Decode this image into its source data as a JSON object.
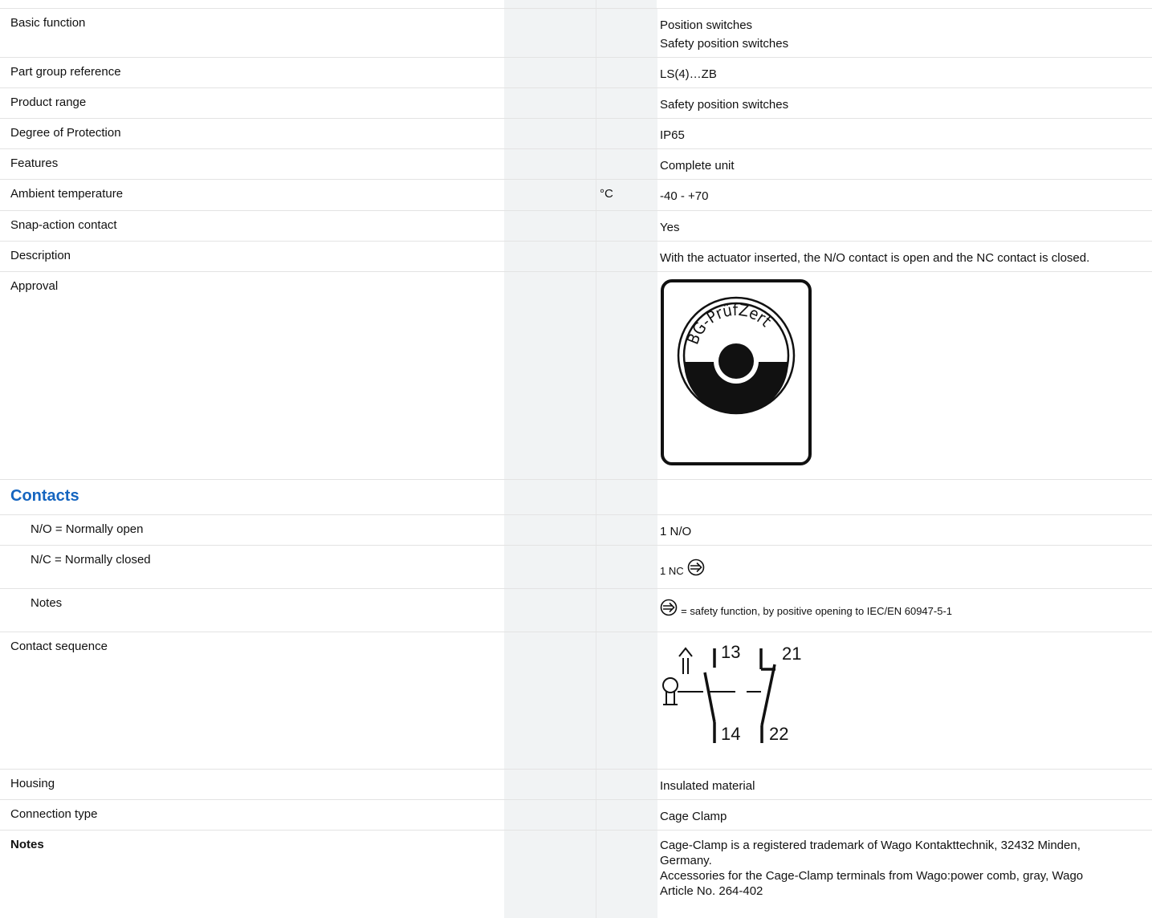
{
  "rows_a": [
    {
      "label": "Basic function",
      "unit": "",
      "value": [
        "Position switches",
        "Safety position switches"
      ]
    },
    {
      "label": "Part group reference",
      "unit": "",
      "value": [
        "LS(4)…ZB"
      ]
    },
    {
      "label": "Product range",
      "unit": "",
      "value": [
        "Safety position switches"
      ]
    },
    {
      "label": "Degree of Protection",
      "unit": "",
      "value": [
        "IP65"
      ]
    },
    {
      "label": "Features",
      "unit": "",
      "value": [
        "Complete unit"
      ]
    },
    {
      "label": "Ambient temperature",
      "unit": "°C",
      "value": [
        "-40 - +70"
      ]
    },
    {
      "label": "Snap-action contact",
      "unit": "",
      "value": [
        "Yes"
      ]
    },
    {
      "label": "Description",
      "unit": "",
      "value": [
        "With the actuator inserted, the N/O contact is open and the NC contact is closed."
      ]
    }
  ],
  "approval": {
    "label": "Approval",
    "logo_text": "BG-PrüfZert"
  },
  "contacts": {
    "title": "Contacts",
    "no_label": "N/O = Normally open",
    "no_value": "1 N/O",
    "nc_label": "N/C = Normally closed",
    "nc_value": "1 NC",
    "notes_label": "Notes",
    "notes_value": "= safety function, by positive opening to IEC/EN 60947-5-1"
  },
  "contact_sequence": {
    "label": "Contact sequence",
    "terminals": [
      "13",
      "14",
      "21",
      "22"
    ]
  },
  "rows_b": [
    {
      "label": "Housing",
      "value": [
        "Insulated material"
      ]
    },
    {
      "label": "Connection type",
      "value": [
        "Cage Clamp"
      ]
    }
  ],
  "notes_row": {
    "label": "Notes",
    "value": [
      "Cage-Clamp is a registered trademark of Wago Kontakttechnik, 32432 Minden,",
      "Germany.",
      "Accessories for the Cage-Clamp terminals from Wago:power comb, gray, Wago",
      "Article No. 264-402"
    ]
  }
}
